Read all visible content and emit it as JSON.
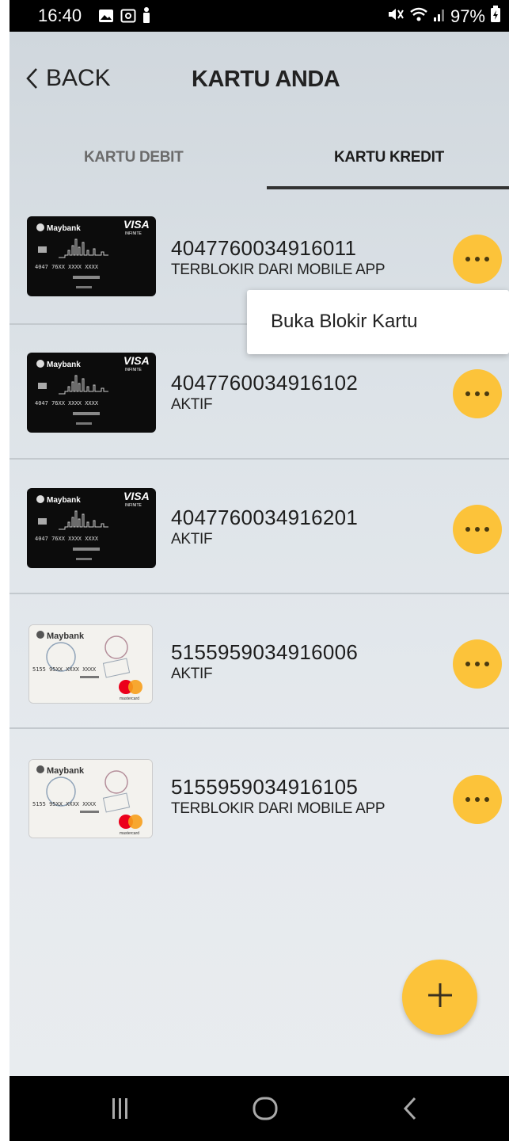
{
  "status_bar": {
    "time": "16:40",
    "battery": "97%",
    "icons": [
      "gallery-icon",
      "screenshot-icon",
      "person-icon",
      "mute-icon",
      "wifi-icon",
      "signal-icon",
      "battery-icon"
    ]
  },
  "header": {
    "back_label": "BACK",
    "title": "KARTU ANDA"
  },
  "tabs": [
    {
      "label": "KARTU DEBIT",
      "active": false
    },
    {
      "label": "KARTU KREDIT",
      "active": true
    }
  ],
  "cards": [
    {
      "number": "4047760034916011",
      "status": "TERBLOKIR DARI MOBILE APP",
      "type": "visa-infinite"
    },
    {
      "number": "4047760034916102",
      "status": "AKTIF",
      "type": "visa-infinite"
    },
    {
      "number": "4047760034916201",
      "status": "AKTIF",
      "type": "visa-infinite"
    },
    {
      "number": "5155959034916006",
      "status": "AKTIF",
      "type": "mastercard"
    },
    {
      "number": "5155959034916105",
      "status": "TERBLOKIR DARI MOBILE APP",
      "type": "mastercard"
    }
  ],
  "popup_menu": {
    "item_label": "Buka Blokir Kartu"
  },
  "card_art": {
    "visa": {
      "bank": "Maybank",
      "brand": "VISA",
      "tier": "INFINITE",
      "masked": "4047 76XX XXXX XXXX"
    },
    "mastercard": {
      "bank": "Maybank",
      "masked": "5155 95XX XXXX XXXX",
      "brand": "mastercard"
    }
  },
  "colors": {
    "accent": "#fcc33a",
    "divider": "#c3c9ce",
    "text": "#1e1e1e"
  }
}
